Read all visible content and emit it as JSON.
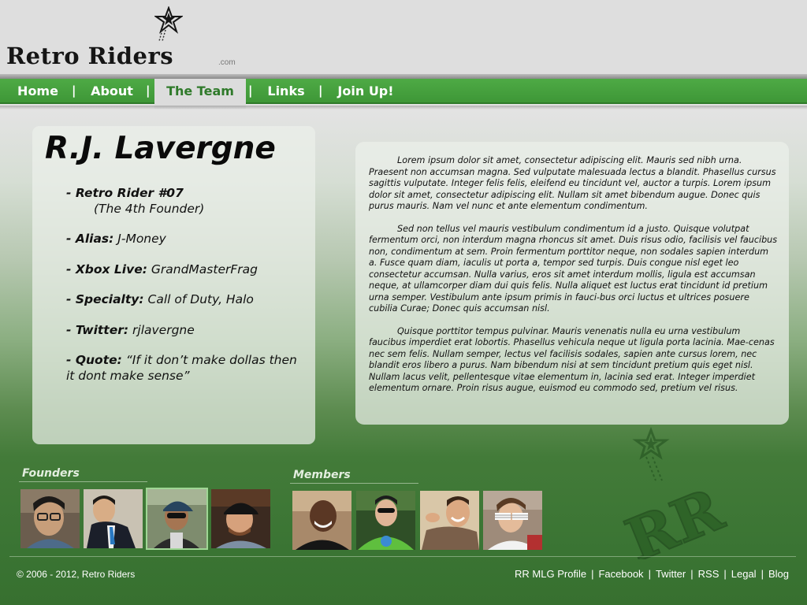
{
  "brand": {
    "logo_text": "Retro Riders",
    "logo_suffix": ".com"
  },
  "nav": {
    "items": [
      {
        "label": "Home"
      },
      {
        "label": "About"
      },
      {
        "label": "The Team",
        "active": true
      },
      {
        "label": "Links"
      },
      {
        "label": "Join Up!"
      }
    ],
    "separator": "|"
  },
  "profile": {
    "name": "R.J. Lavergne",
    "rider_label": "- Retro Rider #07",
    "rider_sub": "(The 4th Founder)",
    "fields": [
      {
        "label": "- Alias:",
        "value": "J-Money"
      },
      {
        "label": "- Xbox Live:",
        "value": "GrandMasterFrag"
      },
      {
        "label": "- Specialty:",
        "value": "Call of Duty, Halo"
      },
      {
        "label": "- Twitter:",
        "value": "rjlavergne"
      },
      {
        "label": "- Quote:",
        "value": "“If it don’t make dollas then it dont make sense”"
      }
    ]
  },
  "bio": {
    "paragraphs": [
      "Lorem ipsum dolor sit amet, consectetur adipiscing elit. Mauris sed nibh urna. Praesent non accumsan magna. Sed vulputate malesuada lectus a blandit. Phasellus cursus sagittis vulputate. Integer felis felis, eleifend eu tincidunt vel, auctor a turpis. Lorem ipsum dolor sit amet, consectetur adipiscing elit. Nullam sit amet bibendum augue. Donec quis purus mauris. Nam vel nunc et ante elementum condimentum.",
      "Sed non tellus vel mauris vestibulum condimentum id a justo. Quisque volutpat fermentum orci, non interdum magna rhoncus sit amet. Duis risus odio, facilisis vel faucibus non, condimentum at sem. Proin fermentum porttitor neque, non sodales sapien interdum a. Fusce quam diam, iaculis ut porta a, tempor sed turpis. Duis congue nisl eget leo consectetur accumsan. Nulla varius, eros sit amet interdum mollis, ligula est accumsan neque, at ullamcorper diam dui quis felis. Nulla aliquet est luctus erat tincidunt id pretium urna semper. Vestibulum ante ipsum primis in fauci-bus orci luctus et ultrices posuere cubilia Curae; Donec quis accumsan nisl.",
      "Quisque porttitor tempus pulvinar. Mauris venenatis nulla eu urna vestibulum faucibus imperdiet erat lobortis. Phasellus vehicula neque ut ligula porta lacinia. Mae-cenas nec sem felis. Nullam semper, lectus vel facilisis sodales, sapien ante cursus lorem, nec blandit eros libero a purus. Nam bibendum nisi at sem tincidunt pretium quis eget nisl. Nullam lacus velit, pellentesque vitae elementum in, lacinia sed erat. Integer imperdiet elementum ornare. Proin risus augue, euismod eu commodo sed, pretium vel risus."
    ]
  },
  "team": {
    "founders_title": "Founders",
    "members_title": "Members",
    "founders": [
      {
        "icon": "person-photo-glasses"
      },
      {
        "icon": "person-photo-suit"
      },
      {
        "icon": "person-photo-cap-sunglasses",
        "selected": true
      },
      {
        "icon": "person-photo-cap"
      }
    ],
    "members": [
      {
        "icon": "person-photo-smiling"
      },
      {
        "icon": "person-photo-sunglasses-green-shirt"
      },
      {
        "icon": "person-photo-pointing"
      },
      {
        "icon": "person-photo-shutter-shades"
      }
    ]
  },
  "colors": {
    "nav_green": "#45a03d",
    "active_tab_text": "#2f7a2a",
    "page_green": "#3a7433"
  },
  "footer": {
    "copyright": "© 2006 - 2012, Retro Riders",
    "links": [
      {
        "label": "RR MLG Profile"
      },
      {
        "label": "Facebook"
      },
      {
        "label": "Twitter"
      },
      {
        "label": "RSS"
      },
      {
        "label": "Legal"
      },
      {
        "label": "Blog"
      }
    ],
    "separator": "|"
  }
}
